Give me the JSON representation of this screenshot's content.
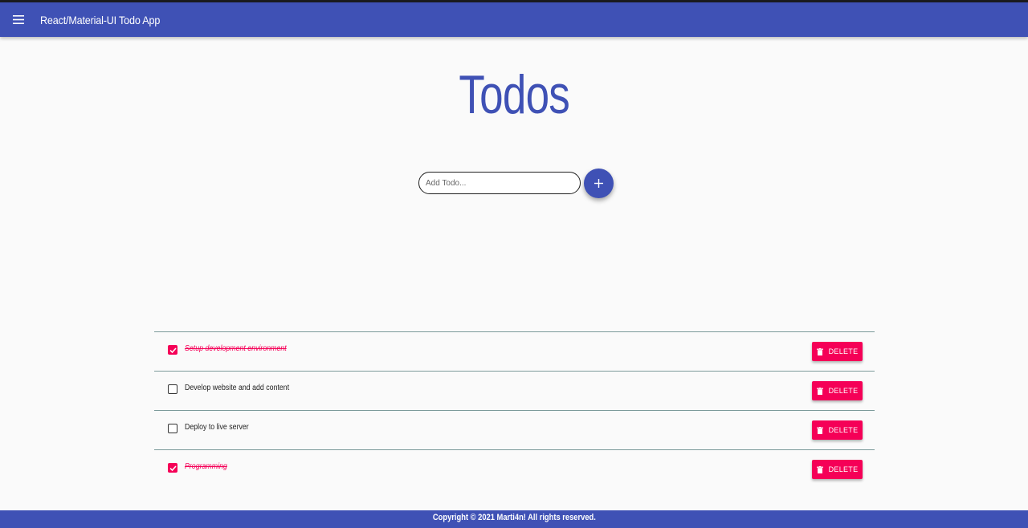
{
  "appbar": {
    "title": "React/Material-UI Todo App",
    "menu_icon": "hamburger-menu-icon",
    "color": "#3f51b5"
  },
  "page": {
    "heading": "Todos"
  },
  "add_form": {
    "input_value": "",
    "placeholder": "Add Todo...",
    "add_icon": "plus-icon"
  },
  "todos": [
    {
      "text": "Setup development environment",
      "completed": true,
      "delete_label": "DELETE"
    },
    {
      "text": "Develop website and add content",
      "completed": false,
      "delete_label": "DELETE"
    },
    {
      "text": "Deploy to live server",
      "completed": false,
      "delete_label": "DELETE"
    },
    {
      "text": "Programming",
      "completed": true,
      "delete_label": "DELETE"
    }
  ],
  "footer": {
    "text": "Copyright © 2021  Marti4n! All rights reserved."
  },
  "colors": {
    "primary": "#3f51b5",
    "secondary": "#f50057"
  }
}
